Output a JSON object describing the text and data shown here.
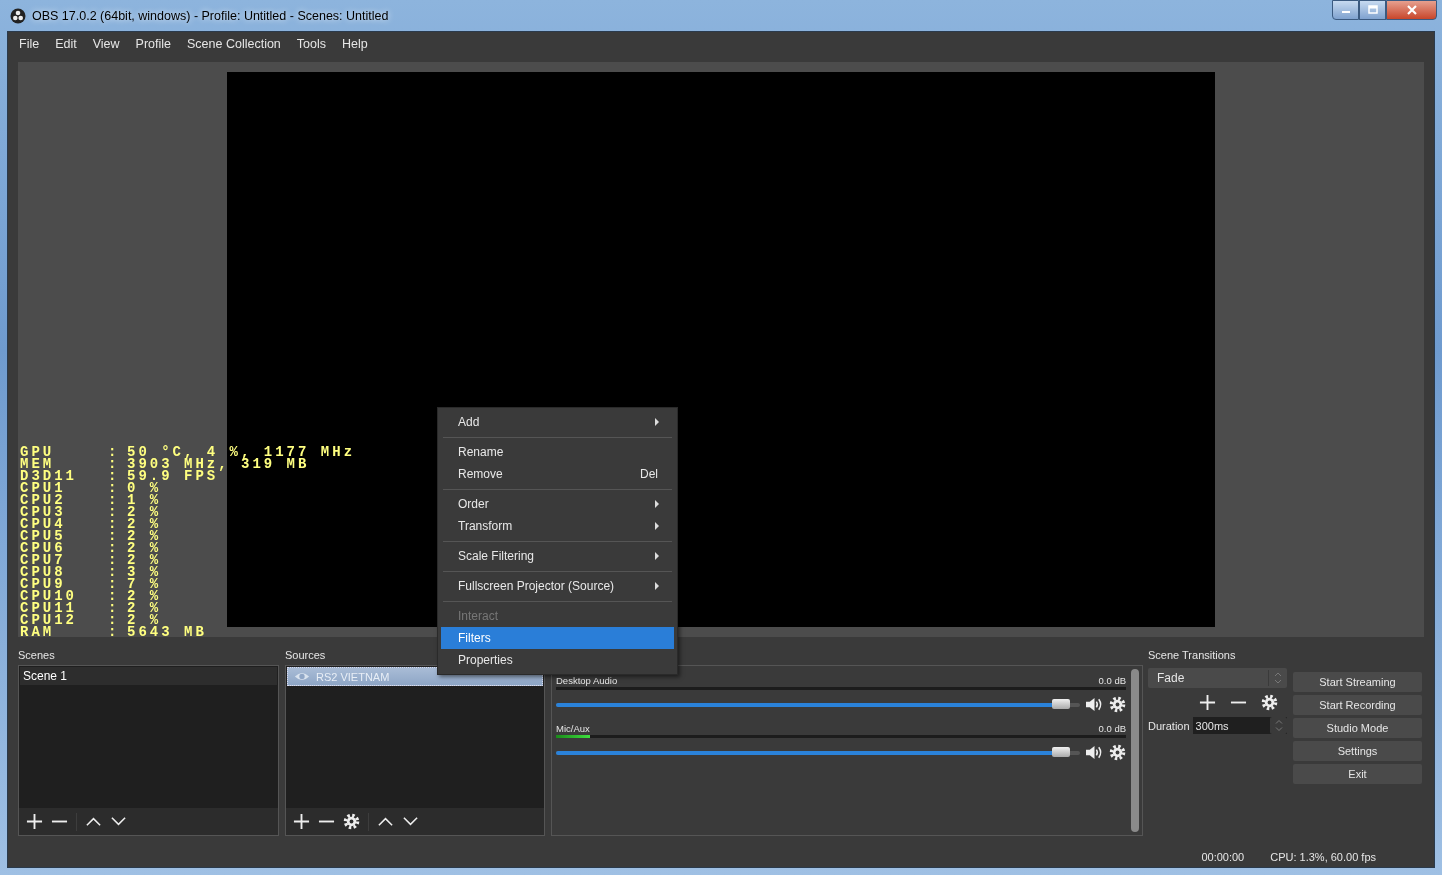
{
  "window": {
    "title": "OBS 17.0.2 (64bit, windows) - Profile: Untitled - Scenes: Untitled"
  },
  "menu_bar": [
    "File",
    "Edit",
    "View",
    "Profile",
    "Scene Collection",
    "Tools",
    "Help"
  ],
  "stats_overlay": [
    {
      "label": "GPU",
      "value": "50 °C, 4 %, 1177 MHz"
    },
    {
      "label": "MEM",
      "value": "3903 MHz, 319 MB"
    },
    {
      "label": "D3D11",
      "value": "59.9 FPS"
    },
    {
      "label": "CPU1",
      "value": "0 %"
    },
    {
      "label": "CPU2",
      "value": "1 %"
    },
    {
      "label": "CPU3",
      "value": "2 %"
    },
    {
      "label": "CPU4",
      "value": "2 %"
    },
    {
      "label": "CPU5",
      "value": "2 %"
    },
    {
      "label": "CPU6",
      "value": "2 %"
    },
    {
      "label": "CPU7",
      "value": "2 %"
    },
    {
      "label": "CPU8",
      "value": "3 %"
    },
    {
      "label": "CPU9",
      "value": "7 %"
    },
    {
      "label": "CPU10",
      "value": "2 %"
    },
    {
      "label": "CPU11",
      "value": "2 %"
    },
    {
      "label": "CPU12",
      "value": "2 %"
    },
    {
      "label": "RAM",
      "value": "5643 MB"
    }
  ],
  "stats_separator": ":",
  "scenes": {
    "title": "Scenes",
    "items": [
      {
        "name": "Scene 1",
        "selected": true
      }
    ]
  },
  "sources": {
    "title": "Sources",
    "items": [
      {
        "name": "RS2 VIETNAM",
        "selected": true,
        "visible": true
      }
    ]
  },
  "mixer": {
    "channels": [
      {
        "name": "Desktop Audio",
        "reading": "0.0 dB",
        "meter": {
          "level": 0
        },
        "level": 0.98,
        "muted": false
      },
      {
        "name": "Mic/Aux",
        "reading": "0.0 dB",
        "meter": {
          "level": 0.06
        },
        "level": 0.98,
        "muted": false
      }
    ]
  },
  "scene_transitions": {
    "title": "Scene Transitions",
    "transition": "Fade",
    "duration_label": "Duration",
    "duration": "300ms"
  },
  "controls": [
    "Start Streaming",
    "Start Recording",
    "Studio Mode",
    "Settings",
    "Exit"
  ],
  "status_bar": {
    "time": "00:00:00",
    "cpu": "CPU: 1.3%, 60.00 fps"
  },
  "context_menu": {
    "groups": [
      [
        {
          "label": "Add",
          "submenu": true,
          "disabled": false,
          "selected": false
        }
      ],
      [
        {
          "label": "Rename",
          "submenu": false,
          "disabled": false,
          "selected": false
        },
        {
          "label": "Remove",
          "shortcut": "Del",
          "submenu": false,
          "disabled": false,
          "selected": false
        }
      ],
      [
        {
          "label": "Order",
          "submenu": true,
          "disabled": false,
          "selected": false
        },
        {
          "label": "Transform",
          "submenu": true,
          "disabled": false,
          "selected": false
        }
      ],
      [
        {
          "label": "Scale Filtering",
          "submenu": true,
          "disabled": false,
          "selected": false
        }
      ],
      [
        {
          "label": "Fullscreen Projector (Source)",
          "submenu": true,
          "disabled": false,
          "selected": false
        }
      ],
      [
        {
          "label": "Interact",
          "submenu": false,
          "disabled": true,
          "selected": false
        },
        {
          "label": "Filters",
          "submenu": false,
          "disabled": false,
          "selected": true
        },
        {
          "label": "Properties",
          "submenu": false,
          "disabled": false,
          "selected": false
        }
      ]
    ]
  }
}
